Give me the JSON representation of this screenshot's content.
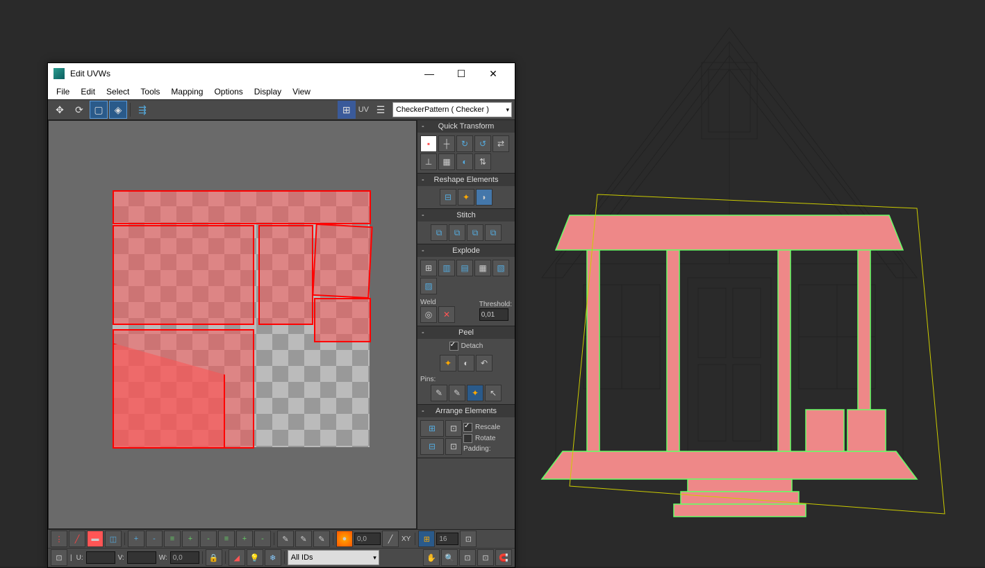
{
  "window": {
    "title": "Edit UVWs",
    "minimize": "—",
    "maximize": "☐",
    "close": "✕"
  },
  "menu": {
    "items": [
      "File",
      "Edit",
      "Select",
      "Tools",
      "Mapping",
      "Options",
      "Display",
      "View"
    ]
  },
  "top_toolbar": {
    "uv_label": "UV",
    "dropdown_value": "CheckerPattern  ( Checker  )"
  },
  "panels": {
    "quick_transform": {
      "title": "Quick Transform"
    },
    "reshape": {
      "title": "Reshape Elements"
    },
    "stitch": {
      "title": "Stitch"
    },
    "explode": {
      "title": "Explode",
      "weld_label": "Weld",
      "threshold_label": "Threshold:",
      "threshold_value": "0,01"
    },
    "peel": {
      "title": "Peel",
      "detach_label": "Detach",
      "pins_label": "Pins:"
    },
    "arrange": {
      "title": "Arrange Elements",
      "rescale_label": "Rescale",
      "rotate_label": "Rotate",
      "padding_label": "Padding:"
    }
  },
  "bottom": {
    "soft_value": "0,0",
    "xy_label": "XY",
    "spinner_value": "16",
    "u_label": "U:",
    "v_label": "V:",
    "w_label": "W:",
    "w_value": "0,0",
    "ids_dropdown": "All IDs"
  }
}
